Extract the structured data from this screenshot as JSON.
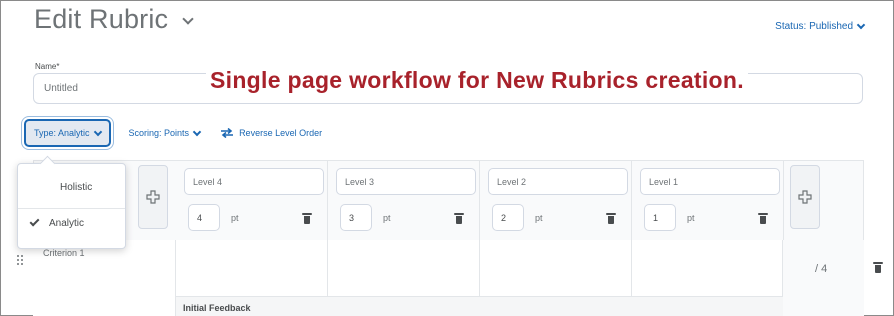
{
  "header": {
    "title": "Edit Rubric",
    "status": "Status: Published"
  },
  "name_field": {
    "label": "Name*",
    "placeholder": "Untitled"
  },
  "annotation": "Single page workflow for New Rubrics creation.",
  "toolbar": {
    "type_label": "Type: Analytic",
    "scoring_label": "Scoring: Points",
    "reverse_label": "Reverse Level Order"
  },
  "type_menu": {
    "options": [
      {
        "label": "Holistic",
        "selected": false
      },
      {
        "label": "Analytic",
        "selected": true
      }
    ]
  },
  "levels": [
    {
      "name": "Level 4",
      "points": "4",
      "unit": "pt"
    },
    {
      "name": "Level 3",
      "points": "3",
      "unit": "pt"
    },
    {
      "name": "Level 2",
      "points": "2",
      "unit": "pt"
    },
    {
      "name": "Level 1",
      "points": "1",
      "unit": "pt"
    }
  ],
  "criteria": [
    {
      "name": "Criterion 1",
      "score": "/ 4",
      "feedback_label": "Initial Feedback"
    }
  ],
  "colors": {
    "accent": "#1a67b3",
    "annotation": "#a8222b"
  }
}
